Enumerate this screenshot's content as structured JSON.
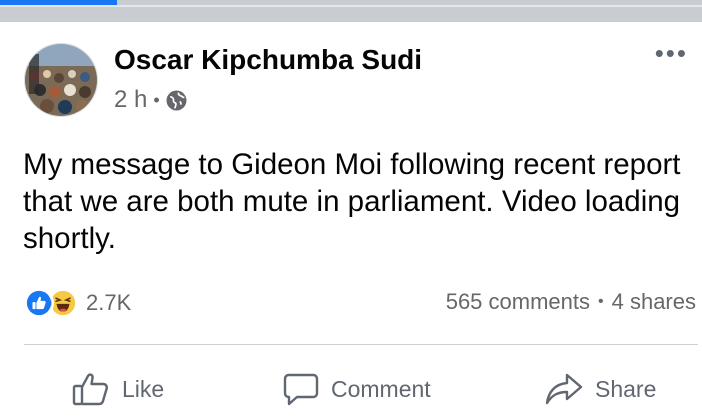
{
  "colors": {
    "accent": "#1877f2",
    "secondary_text": "#65676b",
    "icon": "#606770"
  },
  "post": {
    "author": "Oscar Kipchumba Sudi",
    "time": "2 h",
    "audience_icon": "globe-icon",
    "more_icon": "more-options-icon",
    "message": "My message to Gideon Moi following recent report that we are both mute in parliament. Video loading shortly."
  },
  "engagement": {
    "reaction_icons": [
      "like-reaction-icon",
      "haha-reaction-icon"
    ],
    "reaction_count": "2.7K",
    "comments": "565 comments",
    "shares": "4 shares"
  },
  "actions": {
    "like": "Like",
    "comment": "Comment",
    "share": "Share"
  }
}
